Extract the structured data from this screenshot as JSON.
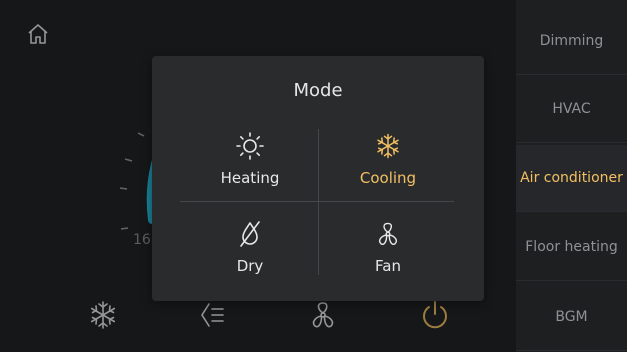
{
  "colors": {
    "accent": "#f2c062",
    "dial": "#27c3e6",
    "text": "#e8e8e8",
    "muted": "#8f9196"
  },
  "home": {
    "icon": "home-icon"
  },
  "dial": {
    "min_label": "16"
  },
  "bottom_bar": [
    {
      "icon": "snowflake-icon"
    },
    {
      "icon": "fan-speed-icon"
    },
    {
      "icon": "fan-icon"
    },
    {
      "icon": "power-icon"
    }
  ],
  "sidebar": {
    "items": [
      {
        "label": "Dimming",
        "active": false
      },
      {
        "label": "HVAC",
        "active": false
      },
      {
        "label": "Air conditioner",
        "active": true
      },
      {
        "label": "Floor heating",
        "active": false
      },
      {
        "label": "BGM",
        "active": false
      }
    ]
  },
  "modal": {
    "title": "Mode",
    "options": [
      {
        "label": "Heating",
        "icon": "sun-icon",
        "selected": false
      },
      {
        "label": "Cooling",
        "icon": "snowflake-icon",
        "selected": true
      },
      {
        "label": "Dry",
        "icon": "dry-icon",
        "selected": false
      },
      {
        "label": "Fan",
        "icon": "fan-icon",
        "selected": false
      }
    ]
  }
}
